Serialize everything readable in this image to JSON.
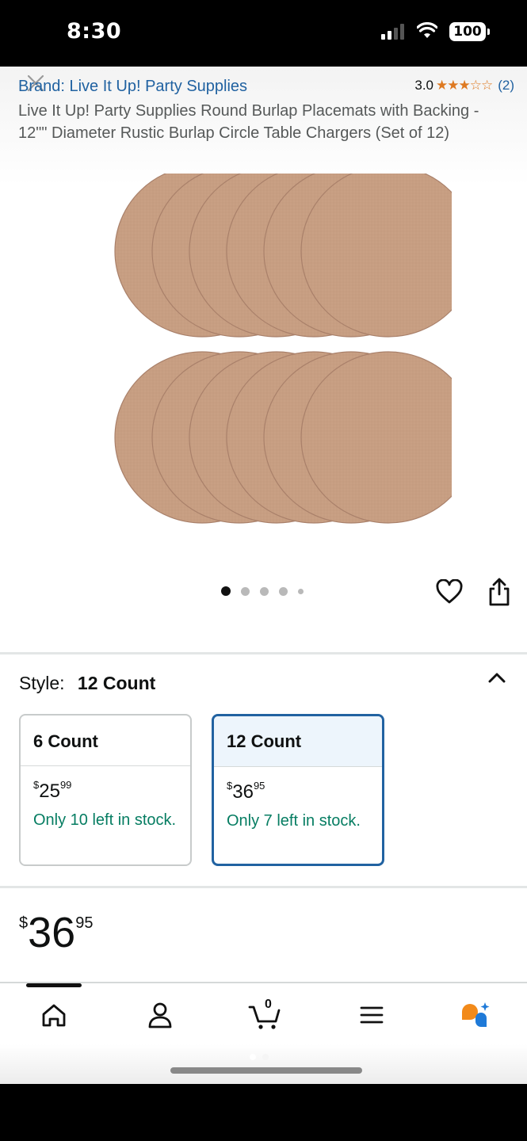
{
  "status_bar": {
    "time": "8:30",
    "battery": "100"
  },
  "product": {
    "brand_link": "Brand: Live It Up! Party Supplies",
    "rating_value": "3.0",
    "rating_stars": 3,
    "rating_count": "(2)",
    "title": "Live It Up! Party Supplies Round Burlap Placemats with Backing - 12\"\" Diameter Rustic Burlap Circle Table Chargers (Set of 12)",
    "image_color": "#c9a084",
    "carousel_dots": 5,
    "carousel_active": 0
  },
  "style_selector": {
    "label": "Style:",
    "selected_value": "12 Count",
    "options": [
      {
        "name": "6 Count",
        "price_symbol": "$",
        "price_whole": "25",
        "price_fraction": "99",
        "stock": "Only 10 left in stock."
      },
      {
        "name": "12 Count",
        "price_symbol": "$",
        "price_whole": "36",
        "price_fraction": "95",
        "stock": "Only 7 left in stock."
      }
    ]
  },
  "price": {
    "symbol": "$",
    "whole": "36",
    "fraction": "95"
  },
  "bottom_nav": {
    "cart_count": "0",
    "items": [
      "home-icon",
      "account-icon",
      "cart-icon",
      "menu-icon",
      "rufus-icon"
    ]
  },
  "colors": {
    "link": "#2162a1",
    "star": "#de7921",
    "stock_green": "#067d62",
    "selected_border": "#2162a1"
  }
}
